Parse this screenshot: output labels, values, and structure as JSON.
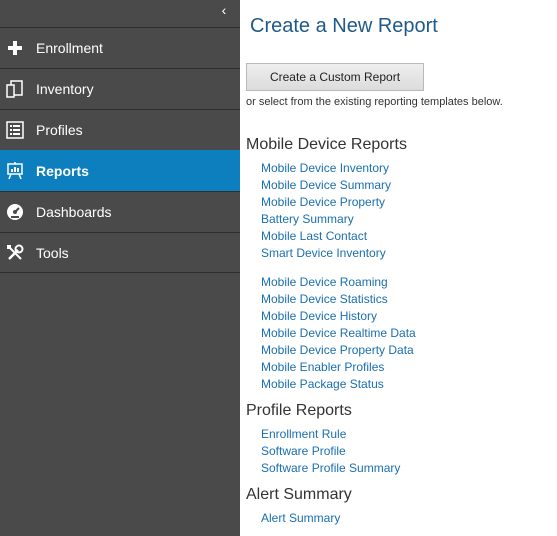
{
  "sidebar": {
    "collapse_glyph": "‹",
    "items": [
      {
        "label": "Enrollment",
        "icon": "plus-icon"
      },
      {
        "label": "Inventory",
        "icon": "devices-icon"
      },
      {
        "label": "Profiles",
        "icon": "list-icon"
      },
      {
        "label": "Reports",
        "icon": "presentation-icon",
        "active": true
      },
      {
        "label": "Dashboards",
        "icon": "gauge-icon"
      },
      {
        "label": "Tools",
        "icon": "wrench-icon"
      }
    ]
  },
  "main": {
    "title": "Create a New Report",
    "custom_button_label": "Create a Custom Report",
    "hint": "or select from the existing reporting templates below.",
    "sections": [
      {
        "title": "Mobile Device Reports",
        "groups": [
          [
            "Mobile Device Inventory",
            "Mobile Device Summary",
            "Mobile Device Property",
            "Battery Summary",
            "Mobile Last Contact",
            "Smart Device Inventory"
          ],
          [
            "Mobile Device Roaming",
            "Mobile Device Statistics",
            "Mobile Device History",
            "Mobile Device Realtime Data",
            "Mobile Device Property Data",
            "Mobile Enabler Profiles",
            "Mobile Package Status"
          ]
        ]
      },
      {
        "title": "Profile Reports",
        "groups": [
          [
            "Enrollment Rule",
            "Software Profile",
            "Software Profile Summary"
          ]
        ]
      },
      {
        "title": "Alert Summary",
        "groups": [
          [
            "Alert Summary"
          ]
        ]
      }
    ]
  },
  "colors": {
    "sidebar_bg": "#4a4a4a",
    "active_bg": "#0d7fbf",
    "title_color": "#1f5a8a",
    "link_color": "#1a6fb0"
  }
}
